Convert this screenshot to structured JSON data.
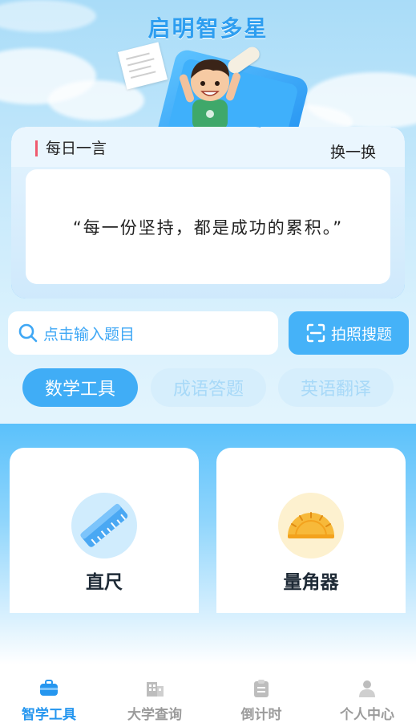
{
  "app": {
    "title": "启明智多星"
  },
  "quote": {
    "title": "每日一言",
    "change_label": "换一换",
    "text": "“每一份坚持，都是成功的累积。”"
  },
  "search": {
    "placeholder": "点击输入题目",
    "photo_button": "拍照搜题"
  },
  "tabs": [
    {
      "label": "数学工具",
      "active": true
    },
    {
      "label": "成语答题",
      "active": false
    },
    {
      "label": "英语翻译",
      "active": false
    }
  ],
  "tools": [
    {
      "label": "直尺",
      "icon": "ruler-icon"
    },
    {
      "label": "量角器",
      "icon": "protractor-icon"
    }
  ],
  "bottom_nav": [
    {
      "label": "智学工具",
      "icon": "toolbox-icon",
      "active": true
    },
    {
      "label": "大学查询",
      "icon": "building-icon",
      "active": false
    },
    {
      "label": "倒计时",
      "icon": "clipboard-icon",
      "active": false
    },
    {
      "label": "个人中心",
      "icon": "person-icon",
      "active": false
    }
  ],
  "colors": {
    "accent": "#2596ef",
    "button": "#45b2f8",
    "quote_bar": "#ef5a6f"
  }
}
